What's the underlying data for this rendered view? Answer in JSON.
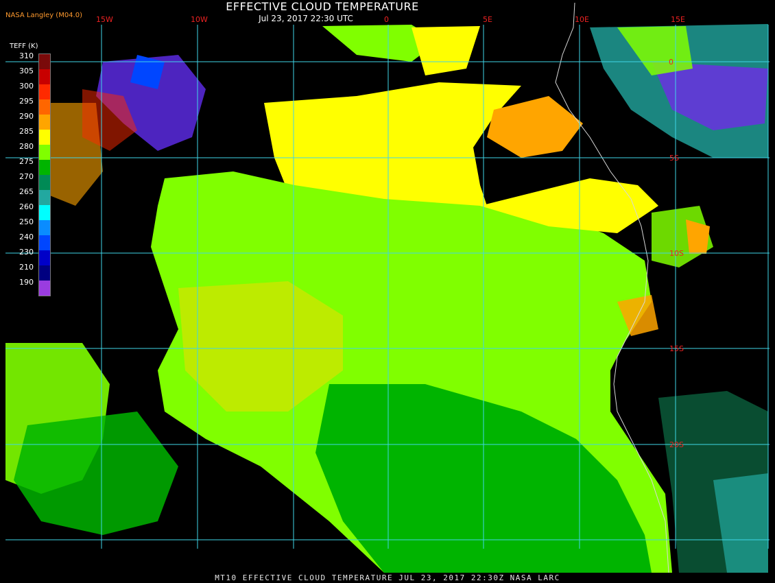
{
  "header": {
    "title": "EFFECTIVE CLOUD TEMPERATURE",
    "subtitle": "Jul 23, 2017 22:30 UTC",
    "source": "NASA Langley (M04.0)"
  },
  "footer": "MT10   EFFECTIVE CLOUD TEMPERATURE   JUL 23, 2017 22:30Z   NASA LARC",
  "legend": {
    "title": "TEFF (K)",
    "levels": [
      {
        "label": "310",
        "color": "#7a0a0a"
      },
      {
        "label": "305",
        "color": "#c80000"
      },
      {
        "label": "300",
        "color": "#ff2a00"
      },
      {
        "label": "295",
        "color": "#ff6600"
      },
      {
        "label": "290",
        "color": "#ffa500"
      },
      {
        "label": "285",
        "color": "#ffff00"
      },
      {
        "label": "280",
        "color": "#80ff00"
      },
      {
        "label": "275",
        "color": "#00b400"
      },
      {
        "label": "270",
        "color": "#008a55"
      },
      {
        "label": "265",
        "color": "#22a8a0"
      },
      {
        "label": "260",
        "color": "#00ffff"
      },
      {
        "label": "250",
        "color": "#0a8cff"
      },
      {
        "label": "240",
        "color": "#0046ff"
      },
      {
        "label": "230",
        "color": "#0000c8"
      },
      {
        "label": "210",
        "color": "#000080"
      },
      {
        "label": "190",
        "color": "#9a3ce0"
      }
    ]
  },
  "grid": {
    "lon_labels": [
      "15W",
      "10W",
      "0",
      "5E",
      "10E",
      "15E"
    ],
    "lat_labels": [
      "0",
      "5S",
      "10S",
      "15S",
      "20S"
    ],
    "color": "#3fd6e8"
  },
  "colors": {
    "background": "#000000",
    "coast": "#d8d8d8"
  }
}
